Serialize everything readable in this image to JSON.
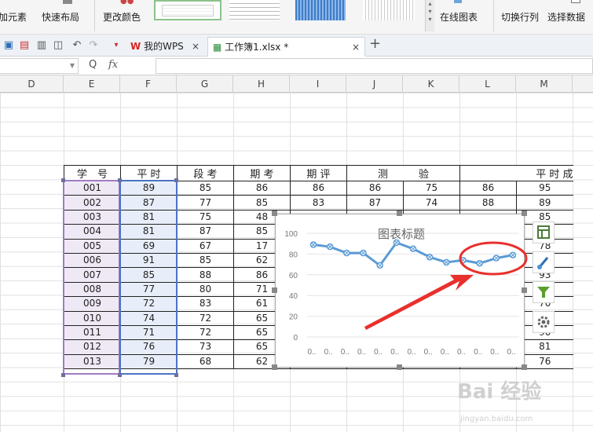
{
  "ribbon": {
    "items": [
      "加元素",
      "快速布局",
      "更改颜色",
      "在线图表",
      "切换行列",
      "选择数据"
    ]
  },
  "tabs": {
    "tab1": "我的WPS",
    "tab2": "工作簿1.xlsx *",
    "close": "×",
    "add": "+"
  },
  "formula": {
    "fx": "fx",
    "zoom": "Q"
  },
  "columns": [
    "D",
    "E",
    "F",
    "G",
    "H",
    "I",
    "J",
    "K",
    "L",
    "M"
  ],
  "table": {
    "headers": [
      "学　号",
      "平 时",
      "段 考",
      "期 考",
      "期 评",
      "测　　　验",
      "",
      "平 时 成"
    ],
    "rows": [
      [
        "001",
        "89",
        "85",
        "86",
        "86",
        "86",
        "75",
        "86",
        "95"
      ],
      [
        "002",
        "87",
        "77",
        "85",
        "83",
        "87",
        "74",
        "88",
        "89"
      ],
      [
        "003",
        "81",
        "75",
        "48",
        "",
        "",
        "",
        "",
        "85"
      ],
      [
        "004",
        "81",
        "87",
        "85",
        "",
        "",
        "",
        "",
        "88"
      ],
      [
        "005",
        "69",
        "67",
        "17",
        "",
        "",
        "",
        "",
        "78"
      ],
      [
        "006",
        "91",
        "85",
        "62",
        "",
        "",
        "",
        "",
        "86"
      ],
      [
        "007",
        "85",
        "88",
        "86",
        "",
        "",
        "",
        "",
        "93"
      ],
      [
        "008",
        "77",
        "80",
        "71",
        "",
        "",
        "",
        "",
        "87"
      ],
      [
        "009",
        "72",
        "83",
        "61",
        "",
        "",
        "",
        "",
        "70"
      ],
      [
        "010",
        "74",
        "72",
        "65",
        "",
        "",
        "",
        "",
        "80"
      ],
      [
        "011",
        "71",
        "72",
        "65",
        "",
        "",
        "",
        "",
        "90"
      ],
      [
        "012",
        "76",
        "73",
        "65",
        "",
        "",
        "",
        "",
        "81"
      ],
      [
        "013",
        "79",
        "68",
        "62",
        "67",
        "64",
        "79",
        "85",
        "76"
      ]
    ]
  },
  "chart_data": {
    "type": "line",
    "title": "图表标题",
    "categories": [
      "0..",
      "0..",
      "0..",
      "0..",
      "0..",
      "0..",
      "0..",
      "0..",
      "0..",
      "0..",
      "0..",
      "0..",
      "0.."
    ],
    "y_ticks": [
      "0",
      "20",
      "40",
      "60",
      "80",
      "100"
    ],
    "ylim": [
      0,
      100
    ],
    "grid": true,
    "series": [
      {
        "values": [
          89,
          87,
          81,
          81,
          69,
          91,
          85,
          77,
          72,
          74,
          71,
          76,
          79
        ]
      }
    ],
    "color": "#5b9bd5"
  },
  "annotations": {
    "arrow_color": "#e8302c",
    "ellipse_color": "#e8302c"
  },
  "watermark": {
    "main": "Bai 经验",
    "sub": "jingyan.baidu.com"
  }
}
